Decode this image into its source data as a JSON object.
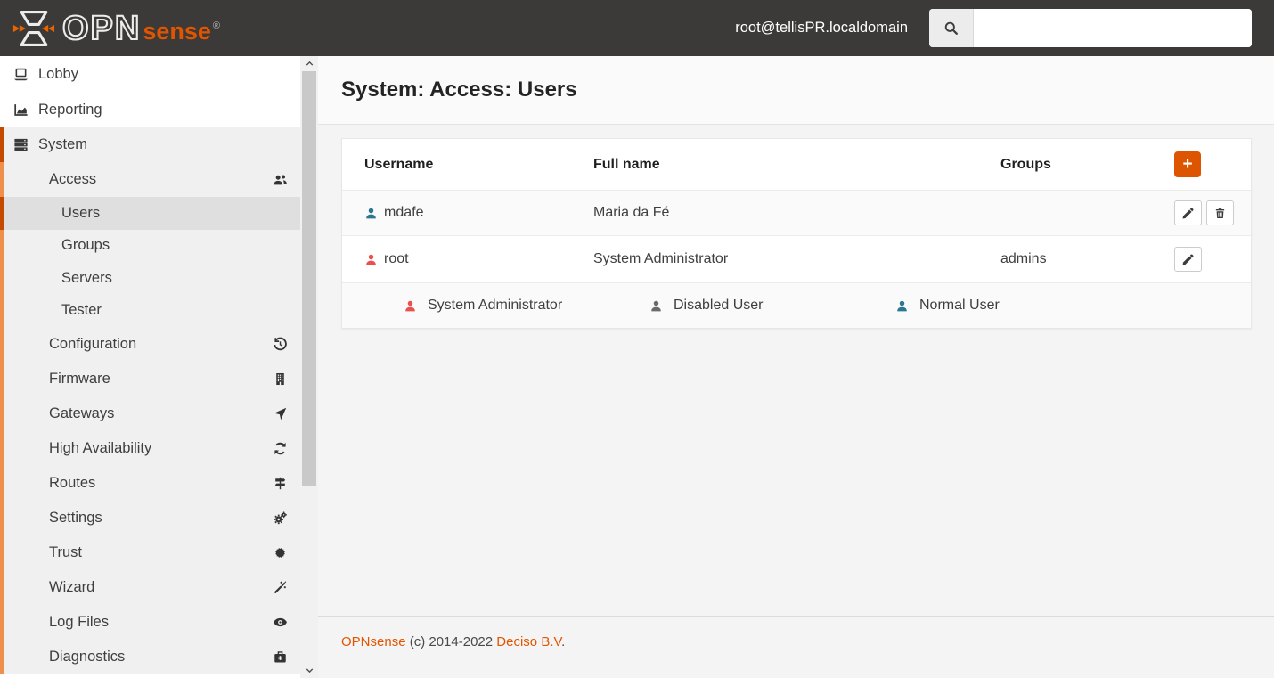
{
  "header": {
    "brand": {
      "primary": "OPN",
      "secondary": "sense",
      "registered": "®"
    },
    "session_user": "root@tellisPR.localdomain",
    "search": {
      "placeholder": "",
      "value": ""
    }
  },
  "sidebar": {
    "items": [
      {
        "label": "Lobby",
        "icon": "laptop",
        "level": 1
      },
      {
        "label": "Reporting",
        "icon": "area-chart",
        "level": 1
      },
      {
        "label": "System",
        "icon": "server",
        "level": 1,
        "state": "expanded-active"
      },
      {
        "label": "Access",
        "icon": "users-group",
        "level": 2
      },
      {
        "label": "Users",
        "level": 3,
        "state": "selected"
      },
      {
        "label": "Groups",
        "level": 3
      },
      {
        "label": "Servers",
        "level": 3
      },
      {
        "label": "Tester",
        "level": 3
      },
      {
        "label": "Configuration",
        "icon": "history",
        "level": 2
      },
      {
        "label": "Firmware",
        "icon": "building",
        "level": 2
      },
      {
        "label": "Gateways",
        "icon": "location-arrow",
        "level": 2
      },
      {
        "label": "High Availability",
        "icon": "refresh",
        "level": 2
      },
      {
        "label": "Routes",
        "icon": "map-signs",
        "level": 2
      },
      {
        "label": "Settings",
        "icon": "cogs",
        "level": 2
      },
      {
        "label": "Trust",
        "icon": "certificate",
        "level": 2
      },
      {
        "label": "Wizard",
        "icon": "magic-wand",
        "level": 2
      },
      {
        "label": "Log Files",
        "icon": "eye",
        "level": 2
      },
      {
        "label": "Diagnostics",
        "icon": "medkit",
        "level": 2
      }
    ]
  },
  "page": {
    "title": "System: Access: Users"
  },
  "users_table": {
    "columns": {
      "username": "Username",
      "full_name": "Full name",
      "groups": "Groups"
    },
    "add_button_label": "+",
    "rows": [
      {
        "username": "mdafe",
        "full_name": "Maria da Fé",
        "groups": "",
        "type": "normal-user",
        "actions": [
          "edit",
          "delete"
        ]
      },
      {
        "username": "root",
        "full_name": "System Administrator",
        "groups": "admins",
        "type": "system-administrator",
        "actions": [
          "edit"
        ]
      }
    ],
    "legend": [
      {
        "label": "System Administrator",
        "color": "#e9504e"
      },
      {
        "label": "Disabled User",
        "color": "#6a6a6a"
      },
      {
        "label": "Normal User",
        "color": "#2b7691"
      }
    ]
  },
  "footer": {
    "link_opnsense": "OPNsense",
    "copyright_text": "(c) 2014-2022",
    "link_deciso": "Deciso B.V",
    "suffix": "."
  },
  "colors": {
    "header_background": "#3b3a38",
    "accent_orange": "#dd5500",
    "active_border_dark": "#c44a00",
    "active_border_light": "#ee8f4b",
    "normal_user": "#2b7691",
    "admin_user": "#e9504e",
    "disabled_user": "#6a6a6a",
    "selected_item_background": "#dfdfdf",
    "section_background": "#f0f0f0"
  }
}
